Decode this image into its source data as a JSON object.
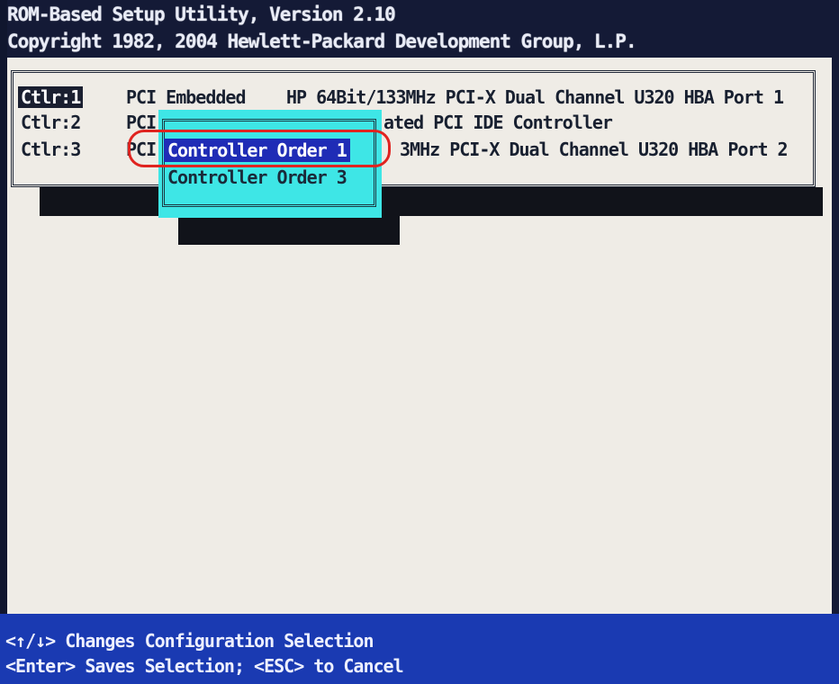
{
  "header": {
    "title": "ROM-Based Setup Utility, Version 2.10",
    "copyright": "Copyright 1982, 2004 Hewlett-Packard Development Group, L.P."
  },
  "controllers": [
    {
      "id": "Ctlr:1",
      "bus": "PCI Embedded",
      "description": "HP 64Bit/133MHz PCI-X Dual Channel U320 HBA Port 1",
      "selected": true
    },
    {
      "id": "Ctlr:2",
      "bus": "PCI",
      "description": "ated PCI IDE Controller",
      "selected": false
    },
    {
      "id": "Ctlr:3",
      "bus": "PCI",
      "description": "3MHz PCI-X Dual Channel U320 HBA Port 2",
      "selected": false
    }
  ],
  "popup": {
    "items": [
      {
        "label": "Controller Order 1",
        "selected": true
      },
      {
        "label": "Controller Order 3",
        "selected": false
      }
    ]
  },
  "help": {
    "line1": "<↑/↓> Changes Configuration Selection",
    "line2": "<Enter> Saves Selection; <ESC> to Cancel"
  },
  "colors": {
    "screen_background": "#141a36",
    "panel_background": "#efece6",
    "popup_background": "#3ee6e6",
    "popup_selection": "#1f2cb6",
    "status_bar": "#1a3ab2",
    "annotation_ring": "#e02420"
  }
}
